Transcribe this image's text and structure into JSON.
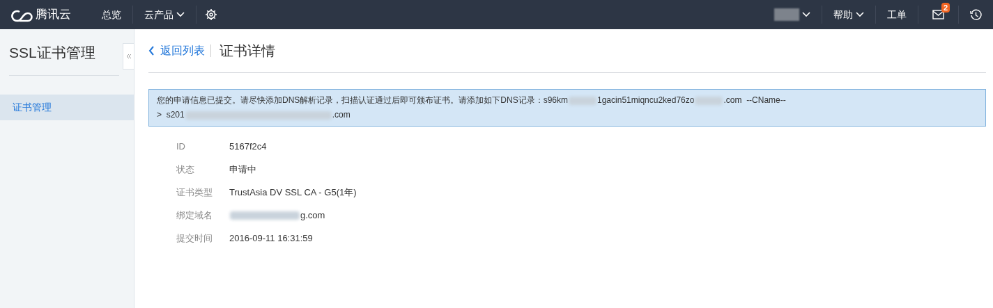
{
  "topbar": {
    "brand": "腾讯云",
    "nav": [
      {
        "kind": "link",
        "label": "总览"
      },
      {
        "kind": "dropdown",
        "label": "云产品"
      },
      {
        "kind": "settings"
      }
    ],
    "right": [
      {
        "kind": "user"
      },
      {
        "kind": "dropdown",
        "label": "帮助"
      },
      {
        "kind": "link",
        "label": "工单"
      },
      {
        "kind": "mail",
        "badge": "2"
      },
      {
        "kind": "history"
      }
    ]
  },
  "sidebar": {
    "title": "SSL证书管理",
    "items": [
      {
        "label": "证书管理",
        "selected": true
      }
    ]
  },
  "header": {
    "back": "返回列表",
    "title": "证书详情"
  },
  "notice": {
    "lines": [
      [
        {
          "kind": "text",
          "text": "您的申请信息已提交。请尽快添加DNS解析记录，扫描认证通过后即可颁布证书。请添加如下DNS记录：s96km"
        },
        {
          "kind": "redacted"
        },
        {
          "kind": "text",
          "text": "1gacin51miqncu2ked76zo"
        },
        {
          "kind": "redacted"
        },
        {
          "kind": "text",
          "text": ".com  --CName--"
        }
      ],
      [
        {
          "kind": "text",
          "text": ">  s201"
        },
        {
          "kind": "redacted"
        },
        {
          "kind": "text",
          "text": ".com"
        }
      ]
    ]
  },
  "details": [
    {
      "label": "ID",
      "value": [
        {
          "kind": "text",
          "text": "5167f2c4"
        }
      ]
    },
    {
      "label": "状态",
      "value": [
        {
          "kind": "text",
          "text": "申请中"
        }
      ]
    },
    {
      "label": "证书类型",
      "value": [
        {
          "kind": "text",
          "text": "TrustAsia DV SSL CA - G5(1年)"
        }
      ]
    },
    {
      "label": "绑定域名",
      "value": [
        {
          "kind": "redacted"
        },
        {
          "kind": "text",
          "text": "g.com"
        }
      ]
    },
    {
      "label": "提交时间",
      "value": [
        {
          "kind": "text",
          "text": "2016-09-11 16:31:59"
        }
      ]
    }
  ]
}
